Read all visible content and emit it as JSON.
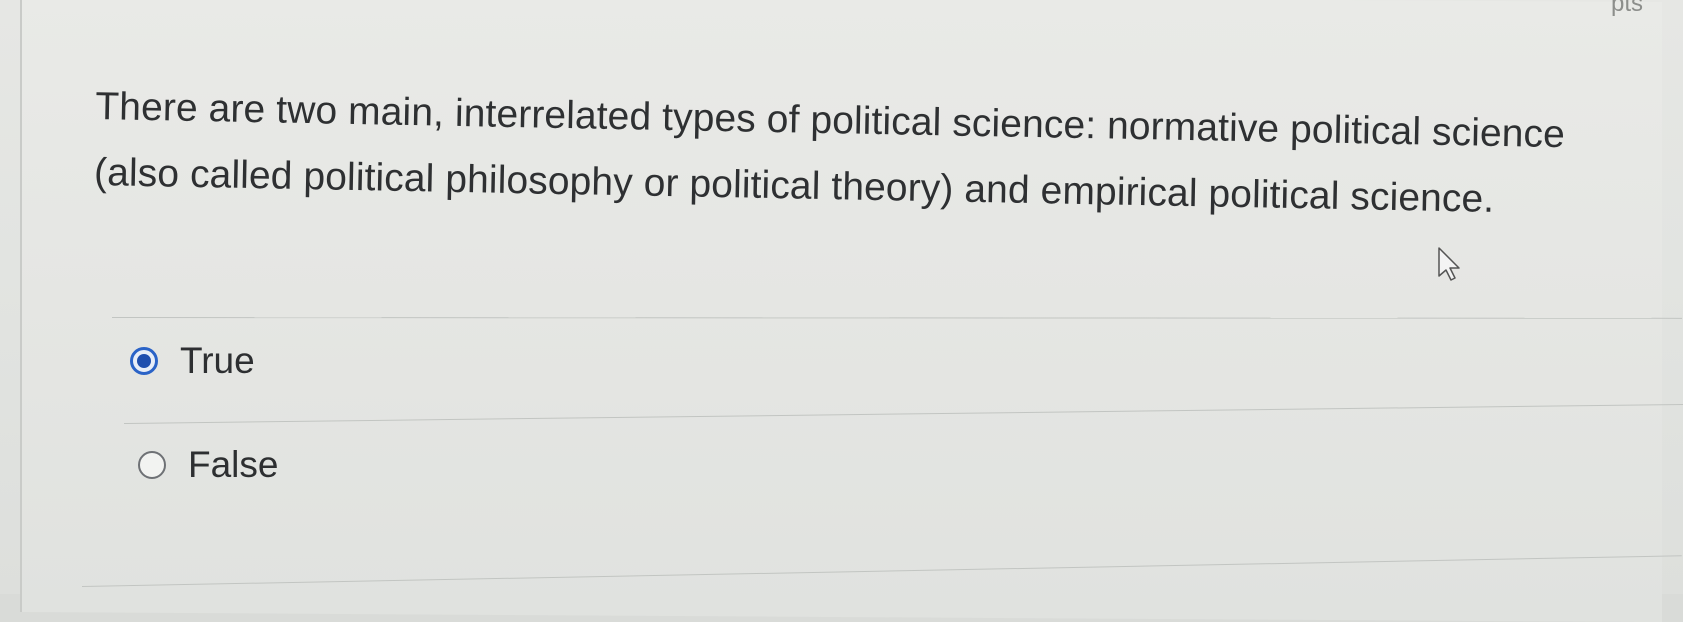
{
  "header": {
    "points": "pts"
  },
  "question": {
    "text": "There are two main, interrelated types of political science: normative political science (also called political philosophy or political theory) and empirical political science."
  },
  "answers": [
    {
      "label": "True",
      "selected": true
    },
    {
      "label": "False",
      "selected": false
    }
  ],
  "colors": {
    "radio_selected": "#2a63c7",
    "text": "#2e3032",
    "background": "#e6e7e4"
  }
}
